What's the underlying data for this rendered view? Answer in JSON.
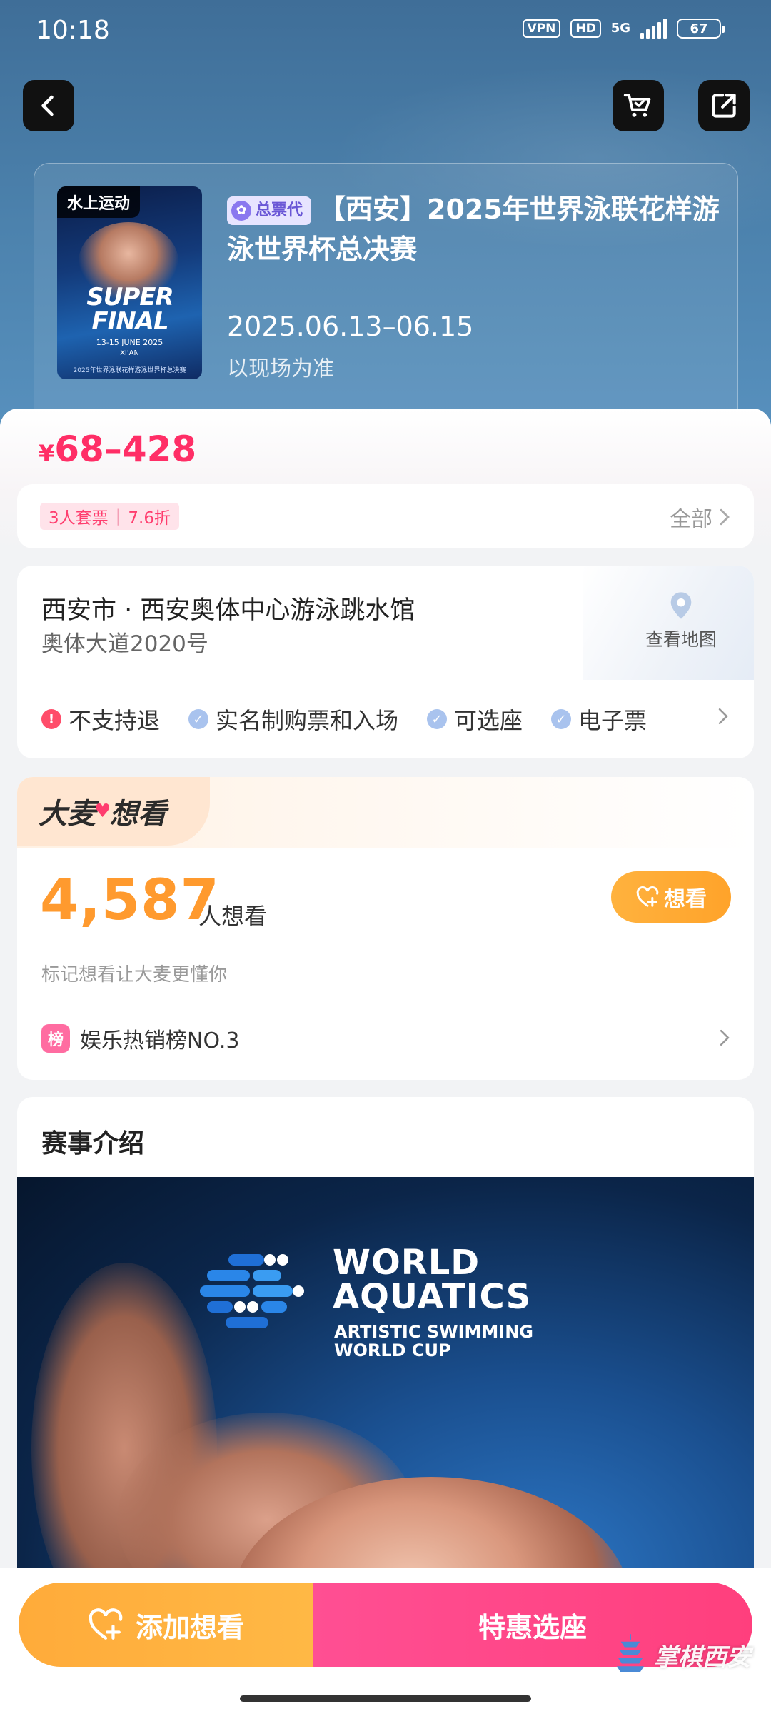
{
  "status_bar": {
    "time": "10:18",
    "vpn": "VPN",
    "hd": "HD",
    "network": "5G",
    "battery": "67"
  },
  "nav": {
    "back_icon": "chevron-left-icon",
    "cart_icon": "cart-icon",
    "share_icon": "share-icon"
  },
  "event": {
    "poster_tag": "水上运动",
    "poster_title_line1": "SUPER",
    "poster_title_line2": "FINAL",
    "poster_dates": "13-15 JUNE 2025",
    "poster_city": "XI'AN",
    "poster_footer": "2025年世界泳联花样游泳世界杯总决赛",
    "badge": "总票代",
    "title": "【西安】2025年世界泳联花样游泳世界杯总决赛",
    "date": "2025.06.13–06.15",
    "date_note": "以现场为准"
  },
  "price": {
    "currency": "¥",
    "range": "68–428"
  },
  "promo": {
    "tag_left": "3人套票",
    "tag_right": "7.6折",
    "all_label": "全部"
  },
  "venue": {
    "name": "西安市 · 西安奥体中心游泳跳水馆",
    "address": "奥体大道2020号",
    "map_label": "查看地图",
    "features": [
      {
        "label": "不支持退",
        "type": "warn"
      },
      {
        "label": "实名制购票和入场",
        "type": "ok"
      },
      {
        "label": "可选座",
        "type": "ok"
      },
      {
        "label": "电子票",
        "type": "ok"
      }
    ]
  },
  "want": {
    "brand_part1": "大麦",
    "brand_part2": "想看",
    "count": "4,587",
    "unit": "人想看",
    "subtitle": "标记想看让大麦更懂你",
    "button_label": "想看",
    "rank_icon_text": "榜",
    "rank_label": "娱乐热销榜NO.3"
  },
  "intro": {
    "title": "赛事介绍",
    "banner_line1": "WORLD",
    "banner_line2": "AQUATICS",
    "banner_line3": "ARTISTIC SWIMMING",
    "banner_line4": "WORLD CUP"
  },
  "bottom": {
    "want_label": "添加想看",
    "seat_label": "特惠选座",
    "watermark": "掌棋西安"
  },
  "colors": {
    "price": "#ff2e66",
    "want_orange": "#ff9a2e",
    "seat_pink": "#ff3f7d"
  }
}
